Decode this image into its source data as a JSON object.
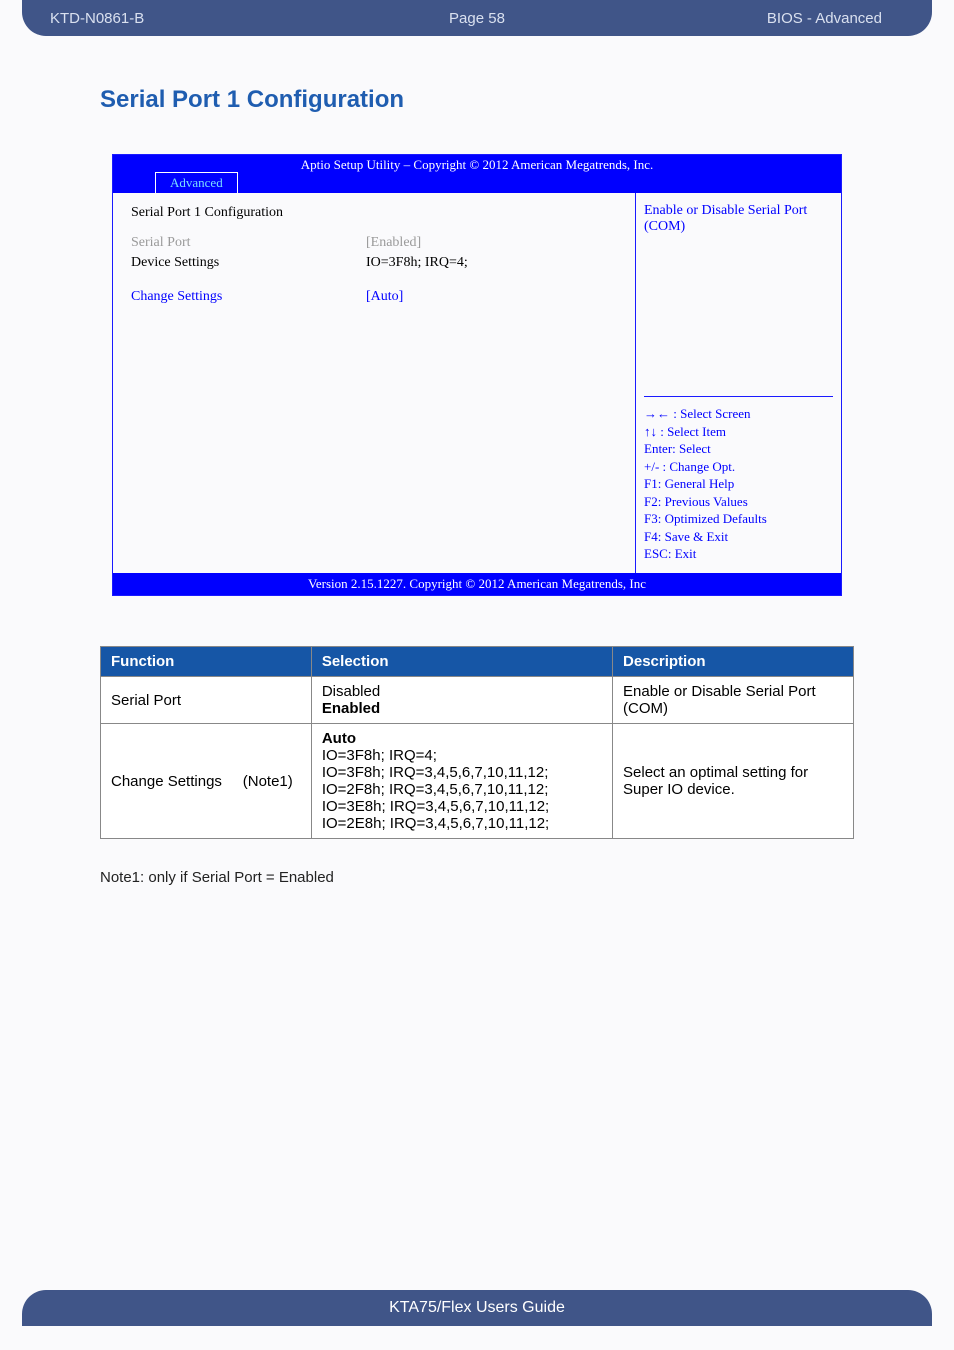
{
  "header": {
    "left": "KTD-N0861-B",
    "center": "Page 58",
    "right": "BIOS  - Advanced"
  },
  "section_title": "Serial Port 1 Configuration",
  "bios": {
    "top_title": "Aptio Setup Utility  –  Copyright © 2012 American Megatrends, Inc.",
    "tab": "Advanced",
    "panel_title": "Serial Port 1 Configuration",
    "rows": {
      "serial_port_label": "Serial Port",
      "serial_port_value": "[Enabled]",
      "device_settings_label": "Device Settings",
      "device_settings_value": "IO=3F8h; IRQ=4;",
      "change_settings_label": "Change Settings",
      "change_settings_value": "[Auto]"
    },
    "help_text": "Enable or Disable Serial Port (COM)",
    "keys": {
      "k1": "→← : Select Screen",
      "k2": "↑↓ : Select Item",
      "k3": "Enter: Select",
      "k4": "+/- : Change Opt.",
      "k5": "F1: General Help",
      "k6": "F2: Previous Values",
      "k7": "F3: Optimized Defaults",
      "k8": "F4: Save & Exit",
      "k9": "ESC: Exit"
    },
    "footer": "Version 2.15.1227. Copyright © 2012 American Megatrends, Inc"
  },
  "table": {
    "h1": "Function",
    "h2": "Selection",
    "h3": "Description",
    "r1": {
      "fn": "Serial Port",
      "sel_l1": "Disabled",
      "sel_l2": "Enabled",
      "desc": "Enable or Disable Serial Port (COM)"
    },
    "r2": {
      "fn": "Change Settings     (Note1)",
      "sel_l1": "Auto",
      "sel_l2": "IO=3F8h; IRQ=4;",
      "sel_l3": "IO=3F8h; IRQ=3,4,5,6,7,10,11,12;",
      "sel_l4": "IO=2F8h; IRQ=3,4,5,6,7,10,11,12;",
      "sel_l5": "IO=3E8h; IRQ=3,4,5,6,7,10,11,12;",
      "sel_l6": "IO=2E8h; IRQ=3,4,5,6,7,10,11,12;",
      "desc": "Select an optimal setting for Super IO device."
    }
  },
  "note": "Note1: only if Serial Port = Enabled",
  "footer_text": "KTA75/Flex Users Guide"
}
